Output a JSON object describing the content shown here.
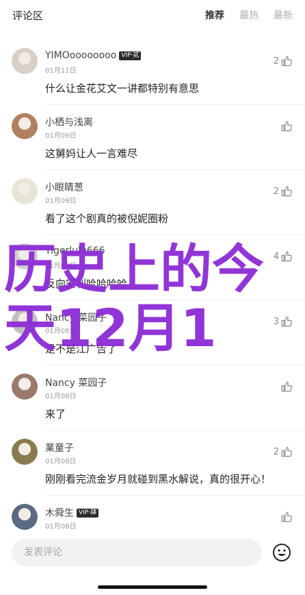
{
  "header": {
    "title": "评论区",
    "tabs": [
      {
        "label": "推荐",
        "active": true
      },
      {
        "label": "最热",
        "active": false
      },
      {
        "label": "最新",
        "active": false
      }
    ]
  },
  "comments": [
    {
      "name": "YIMOoooooooo",
      "vip": "VIP·贰",
      "date": "01月11日",
      "text": "什么让金花艾文一讲都特别有意思",
      "likes": "2",
      "avatar_color": "#d8cfc8"
    },
    {
      "name": "小栖与浅离",
      "vip": "",
      "date": "01月09日",
      "text": "这舅妈让人一言难尽",
      "likes": "",
      "avatar_color": "#b08060"
    },
    {
      "name": "小眼睛葱",
      "vip": "",
      "date": "01月09日",
      "text": "看了这个剧真的被倪妮圈粉",
      "likes": "2",
      "avatar_color": "#e8e4d8"
    },
    {
      "name": "Tigerlulu666",
      "vip": "",
      "date": "01月08日",
      "text": "反向安利哈哈哈哈",
      "likes": "4",
      "avatar_color": "#d0d0d0"
    },
    {
      "name": "Nancy 菜园子",
      "vip": "",
      "date": "01月08日",
      "text": "是不是江广告了",
      "likes": "3",
      "avatar_color": "#c0c0c0"
    },
    {
      "name": "Nancy 菜园子",
      "vip": "",
      "date": "01月08日",
      "text": "来了",
      "likes": "",
      "avatar_color": "#9a7a6a"
    },
    {
      "name": "業童子",
      "vip": "",
      "date": "01月08日",
      "text": "刚刚看完流金岁月就碰到黑水解说，真的很开心！",
      "likes": "2",
      "avatar_color": "#8a7a50"
    },
    {
      "name": "木舜生",
      "vip": "VIP·肆",
      "date": "01月08日",
      "text": "",
      "likes": "",
      "avatar_color": "#5a6a80"
    }
  ],
  "overlay": {
    "line1": "历史上的今",
    "line2": "天12月1",
    "color": "#8e2fd6"
  },
  "input": {
    "placeholder": "发表评论"
  }
}
